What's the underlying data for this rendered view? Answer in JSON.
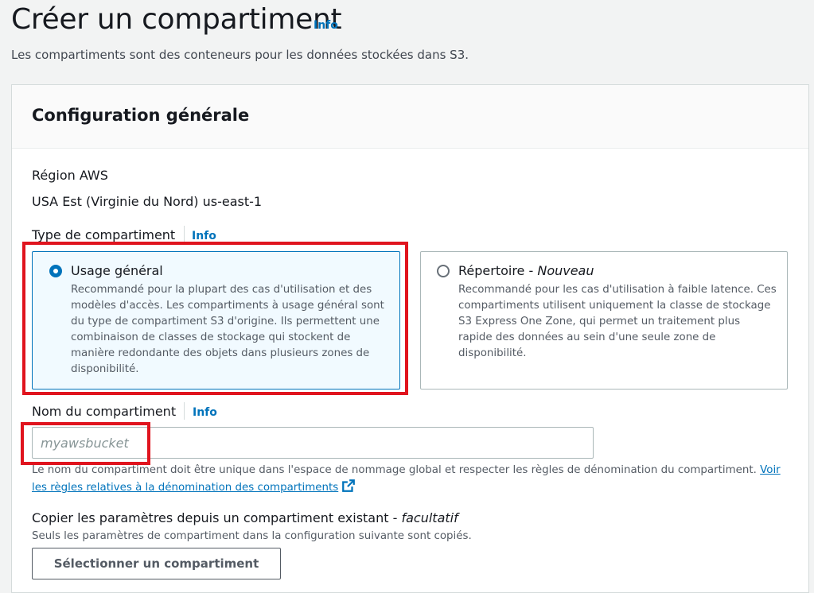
{
  "page": {
    "title": "Créer un compartiment",
    "info": "Info",
    "description": "Les compartiments sont des conteneurs pour les données stockées dans S3."
  },
  "general_config": {
    "title": "Configuration générale",
    "region_label": "Région AWS",
    "region_value": "USA Est (Virginie du Nord) us-east-1",
    "bucket_type": {
      "label": "Type de compartiment",
      "info": "Info",
      "options": [
        {
          "title": "Usage général",
          "selected": true,
          "description": "Recommandé pour la plupart des cas d'utilisation et des modèles d'accès. Les compartiments à usage général sont du type de compartiment S3 d'origine. Ils permettent une combinaison de classes de stockage qui stockent de manière redondante des objets dans plusieurs zones de disponibilité."
        },
        {
          "title": "Répertoire - ",
          "title_suffix": "Nouveau",
          "selected": false,
          "description": "Recommandé pour les cas d'utilisation à faible latence. Ces compartiments utilisent uniquement la classe de stockage S3 Express One Zone, qui permet un traitement plus rapide des données au sein d'une seule zone de disponibilité."
        }
      ]
    },
    "bucket_name": {
      "label": "Nom du compartiment",
      "info": "Info",
      "value": "",
      "placeholder": "myawsbucket",
      "help_text": "Le nom du compartiment doit être unique dans l'espace de nommage global et respecter les règles de dénomination du compartiment. ",
      "help_link": "Voir les règles relatives à la dénomination des compartiments"
    },
    "copy_settings": {
      "label": "Copier les paramètres depuis un compartiment existant - ",
      "label_suffix": "facultatif",
      "description": "Seuls les paramètres de compartiment dans la configuration suivante sont copiés.",
      "button": "Sélectionner un compartiment"
    }
  },
  "colors": {
    "link": "#0073bb",
    "selected_border": "#0073bb",
    "selected_bg": "#f1faff",
    "highlight": "#e0141e"
  },
  "icons": [
    "external-link-icon"
  ]
}
